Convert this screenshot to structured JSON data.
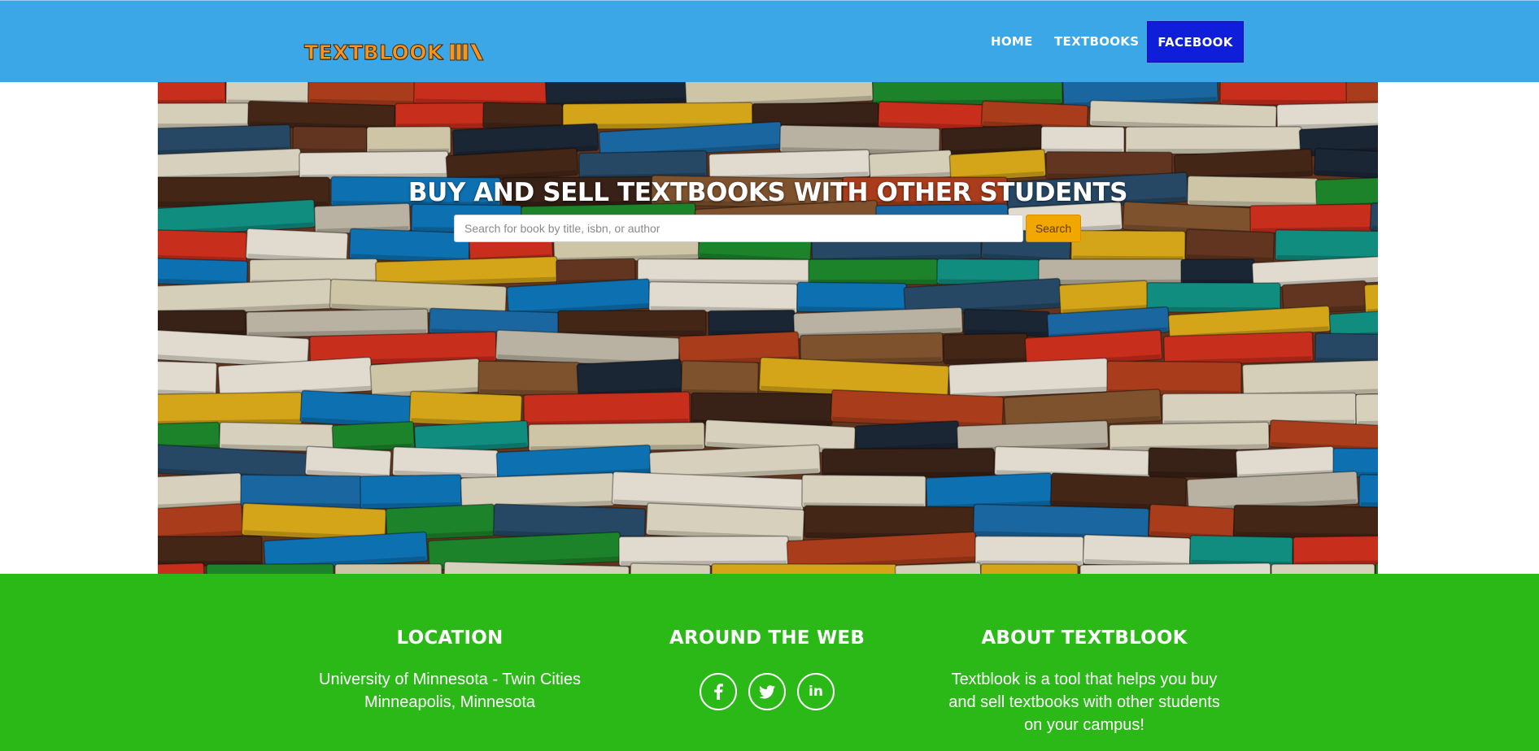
{
  "header": {
    "logo_text": "TEXTBLOOK",
    "nav": {
      "home": "HOME",
      "textbooks": "TEXTBOOKS",
      "facebook": "FACEBOOK"
    }
  },
  "hero": {
    "title": "BUY AND SELL TEXTBOOKS WITH OTHER STUDENTS",
    "search": {
      "placeholder": "Search for book by title, isbn, or author",
      "value": "",
      "button_label": "Search"
    }
  },
  "footer": {
    "location": {
      "heading": "LOCATION",
      "line1": "University of Minnesota - Twin Cities",
      "line2": "Minneapolis, Minnesota"
    },
    "web": {
      "heading": "AROUND THE WEB",
      "icons": [
        "facebook-icon",
        "twitter-icon",
        "linkedin-icon"
      ]
    },
    "about": {
      "heading": "ABOUT TEXTBLOOK",
      "text": "Textblook is a tool that helps you buy and sell textbooks with other students on your campus!"
    }
  },
  "colors": {
    "header_bg": "#3ba7e6",
    "nav_active_bg": "#0f1ed8",
    "logo": "#f7941d",
    "search_button": "#f2a600",
    "footer_bg": "#2bb918"
  }
}
